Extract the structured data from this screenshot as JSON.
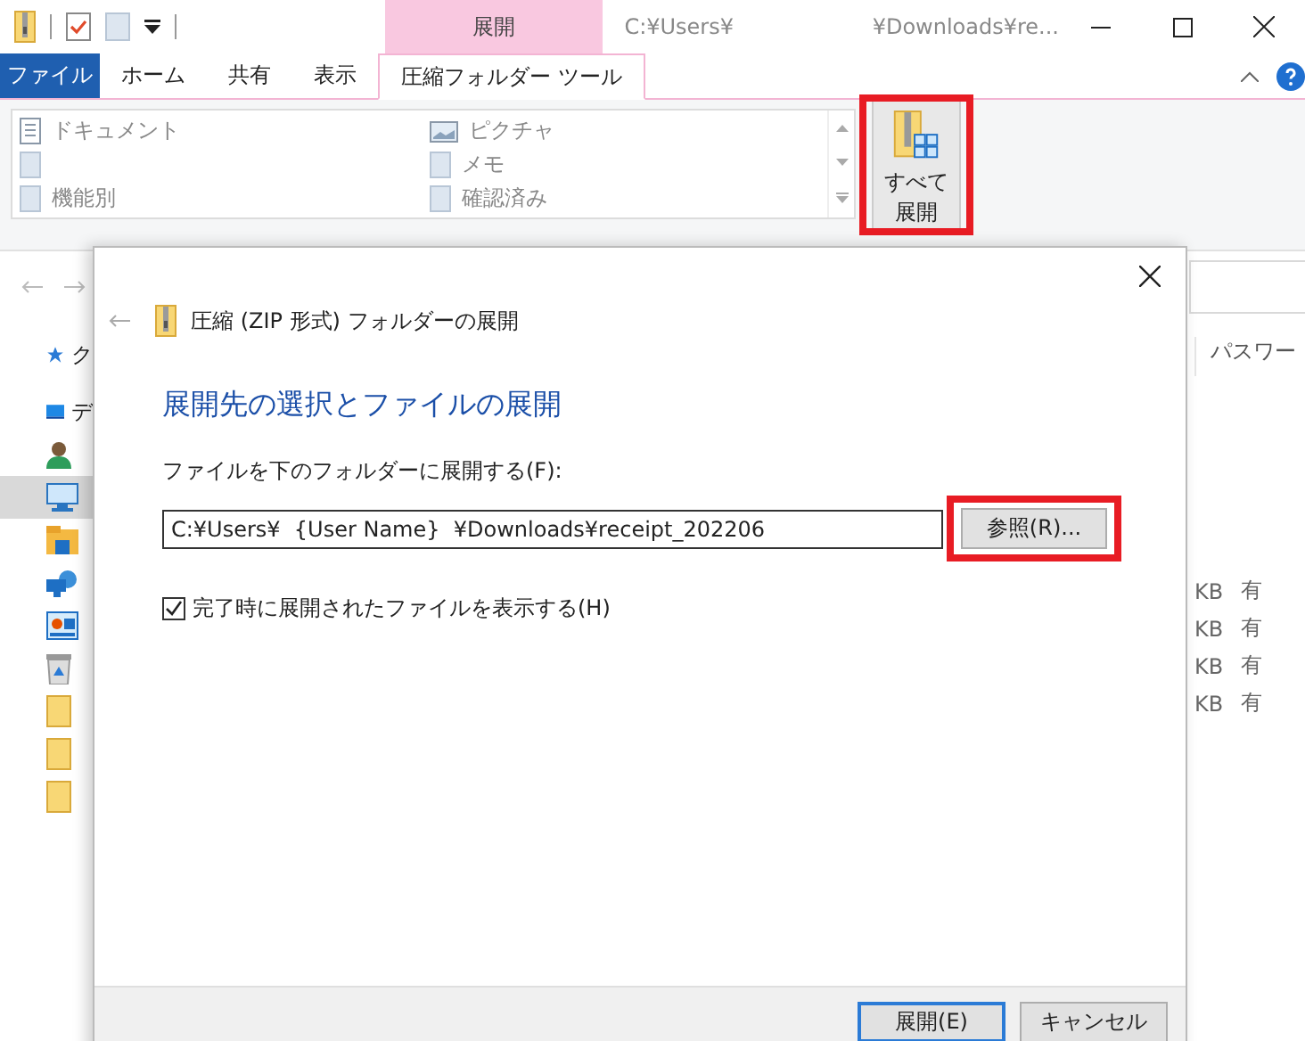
{
  "window": {
    "context_tab": "展開",
    "path_parts": [
      "C:¥Users¥",
      "¥Downloads¥re..."
    ]
  },
  "tabs": [
    {
      "label": "ファイル",
      "kind": "file",
      "selected": false
    },
    {
      "label": "ホーム",
      "kind": "tab",
      "selected": false
    },
    {
      "label": "共有",
      "kind": "tab",
      "selected": false
    },
    {
      "label": "表示",
      "kind": "tab",
      "selected": false
    },
    {
      "label": "圧縮フォルダー ツール",
      "kind": "tab",
      "selected": true
    }
  ],
  "ribbon": {
    "destinations": [
      {
        "label": "ドキュメント",
        "kind": "document"
      },
      {
        "kind": "redacted"
      },
      {
        "label": "機能別",
        "kind": "page"
      },
      {
        "label": "ピクチャ",
        "kind": "picture"
      },
      {
        "label": "メモ",
        "kind": "page"
      },
      {
        "label": "確認済み",
        "kind": "page"
      }
    ],
    "extract_all_button": {
      "lines": [
        "すべて",
        "展開"
      ],
      "highlighted": true
    }
  },
  "navigation": {
    "items": [
      {
        "label": "ク",
        "kind": "star",
        "selected": false
      },
      {
        "label": "デ",
        "kind": "desktop",
        "selected": false
      },
      {
        "kind": "user",
        "selected": false
      },
      {
        "kind": "pc",
        "selected": true
      },
      {
        "kind": "explorer",
        "selected": false
      },
      {
        "kind": "network",
        "selected": false
      },
      {
        "kind": "control",
        "selected": false
      },
      {
        "kind": "recycle",
        "selected": false
      },
      {
        "kind": "folder",
        "selected": false
      },
      {
        "kind": "folder",
        "selected": false
      },
      {
        "kind": "folder",
        "selected": false
      }
    ]
  },
  "file_list": {
    "column_header": "パスワー",
    "rows": [
      {
        "size": "KB",
        "password": "有"
      },
      {
        "size": "KB",
        "password": "有"
      },
      {
        "size": "KB",
        "password": "有"
      },
      {
        "size": "KB",
        "password": "有"
      }
    ]
  },
  "dialog": {
    "title": "圧縮 (ZIP 形式) フォルダーの展開",
    "heading": "展開先の選択とファイルの展開",
    "folder_label": "ファイルを下のフォルダーに展開する(F):",
    "path_value": "C:¥Users¥  {User Name}  ¥Downloads¥receipt_202206",
    "browse_button": {
      "label": "参照(R)...",
      "highlighted": true
    },
    "show_files_checkbox": {
      "label": "完了時に展開されたファイルを表示する(H)",
      "checked": true
    },
    "buttons": [
      {
        "label": "展開(E)",
        "default": true
      },
      {
        "label": "キャンセル",
        "default": false
      }
    ]
  }
}
